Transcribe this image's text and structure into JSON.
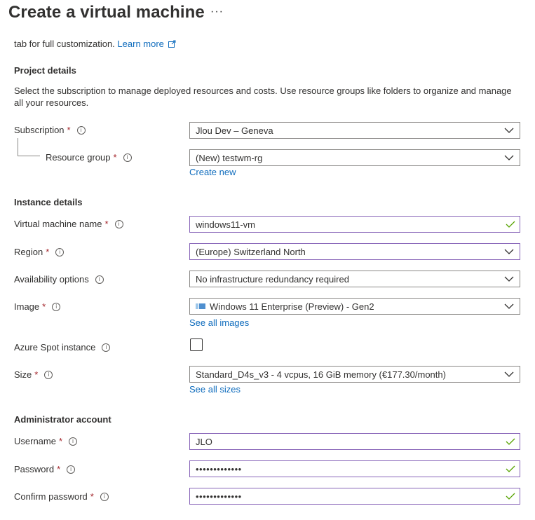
{
  "header": {
    "title": "Create a virtual machine",
    "more": "···"
  },
  "intro": {
    "text": "tab for full customization.",
    "learn_more": "Learn more"
  },
  "project": {
    "heading": "Project details",
    "description": "Select the subscription to manage deployed resources and costs. Use resource groups like folders to organize and manage all your resources.",
    "subscription": {
      "label": "Subscription",
      "value": "Jlou Dev – Geneva"
    },
    "resource_group": {
      "label": "Resource group",
      "value": "(New) testwm-rg",
      "create_new": "Create new"
    }
  },
  "instance": {
    "heading": "Instance details",
    "vm_name": {
      "label": "Virtual machine name",
      "value": "windows11-vm"
    },
    "region": {
      "label": "Region",
      "value": "(Europe) Switzerland North"
    },
    "availability": {
      "label": "Availability options",
      "value": "No infrastructure redundancy required"
    },
    "image": {
      "label": "Image",
      "value": "Windows 11 Enterprise (Preview) - Gen2",
      "see_all": "See all images"
    },
    "spot": {
      "label": "Azure Spot instance",
      "checked": false
    },
    "size": {
      "label": "Size",
      "value": "Standard_D4s_v3 - 4 vcpus, 16 GiB memory (€177.30/month)",
      "see_all": "See all sizes"
    }
  },
  "admin": {
    "heading": "Administrator account",
    "username": {
      "label": "Username",
      "value": "JLO"
    },
    "password": {
      "label": "Password",
      "value": "•••••••••••••"
    },
    "confirm": {
      "label": "Confirm password",
      "value": "•••••••••••••"
    }
  },
  "common": {
    "required_mark": "*",
    "info_glyph": "i"
  },
  "colors": {
    "link": "#0f6cbd",
    "required": "#a4262c",
    "valid_border": "#8764b8",
    "valid_check": "#57a300"
  }
}
